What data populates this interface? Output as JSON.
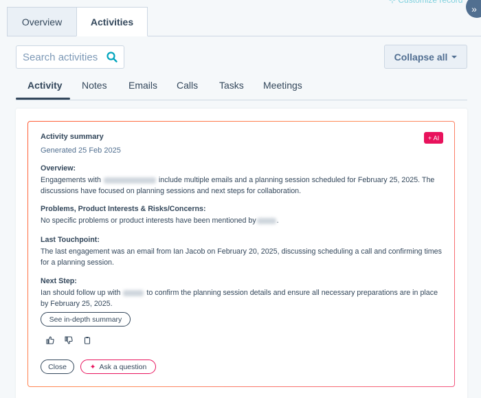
{
  "top_tabs": [
    {
      "label": "Overview",
      "active": false
    },
    {
      "label": "Activities",
      "active": true
    }
  ],
  "search": {
    "placeholder": "Search activities"
  },
  "collapse_button": {
    "label": "Collapse all"
  },
  "sub_tabs": [
    {
      "label": "Activity",
      "active": true
    },
    {
      "label": "Notes"
    },
    {
      "label": "Emails"
    },
    {
      "label": "Calls"
    },
    {
      "label": "Tasks"
    },
    {
      "label": "Meetings"
    }
  ],
  "summary": {
    "title": "Activity summary",
    "generated": "Generated 25 Feb 2025",
    "ai_badge": "AI",
    "overview": {
      "heading": "Overview:",
      "text_pre": "Engagements with",
      "text_post": "include multiple emails and a planning session scheduled for February 25, 2025. The discussions have focused on planning sessions and next steps for collaboration."
    },
    "problems": {
      "heading": "Problems, Product Interests & Risks/Concerns:",
      "text_pre": "No specific problems or product interests have been mentioned by",
      "text_post": "."
    },
    "touchpoint": {
      "heading": "Last Touchpoint:",
      "text": "The last engagement was an email from Ian Jacob on February 20, 2025, discussing scheduling a call and confirming times for a planning session."
    },
    "next_step": {
      "heading": "Next Step:",
      "text_pre": "Ian should follow up with",
      "text_post": "to confirm the planning session details and ensure all necessary preparations are in place by February 25, 2025."
    },
    "in_depth_button": "See in-depth summary",
    "close_button": "Close",
    "ask_button": "Ask a question"
  },
  "colors": {
    "accent_pink": "#e8125c",
    "text": "#33475b",
    "border": "#cbd6e2"
  },
  "icons": [
    "search-icon",
    "thumbs-up-icon",
    "thumbs-down-icon",
    "copy-icon",
    "sparkle-icon",
    "double-chevron-icon"
  ]
}
